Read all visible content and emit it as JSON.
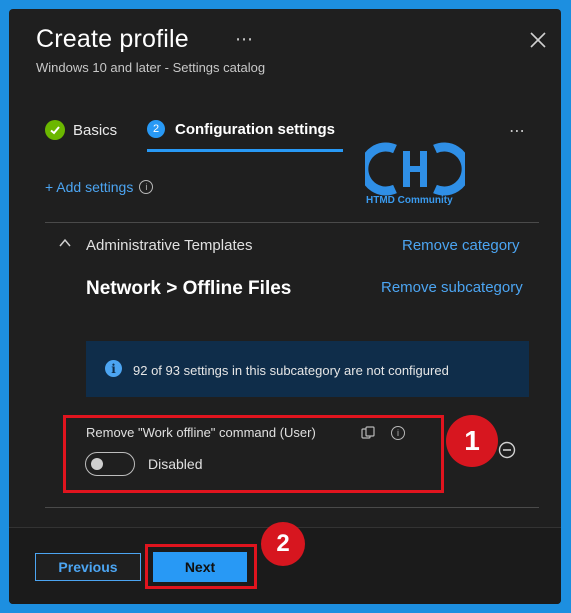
{
  "header": {
    "title": "Create profile",
    "more": "⋯",
    "subtitle": "Windows 10 and later - Settings catalog"
  },
  "tabs": [
    {
      "label": "Basics",
      "step": "✓"
    },
    {
      "label": "Configuration settings",
      "step": "2"
    }
  ],
  "tabs_more": "⋯",
  "watermark": {
    "text": "HTMD Community"
  },
  "add_settings": {
    "label": "+ Add settings",
    "info": "i"
  },
  "category": {
    "name": "Administrative Templates",
    "remove_label": "Remove category",
    "subcategory": "Network > Offline Files",
    "remove_sub_label": "Remove subcategory"
  },
  "info_banner": {
    "icon": "i",
    "text": "92 of 93 settings in this subcategory are not configured"
  },
  "setting": {
    "label": "Remove \"Work offline\" command (User)",
    "info": "i",
    "toggle_state": "Disabled"
  },
  "annotations": {
    "badge_1": "1",
    "badge_2": "2"
  },
  "footer": {
    "previous_label": "Previous",
    "next_label": "Next"
  },
  "colors": {
    "accent": "#2899f5",
    "link": "#4ca5f2",
    "highlight": "#e0141e",
    "success": "#6bb700",
    "page_bg": "#1f1f1f",
    "outer_bg": "#1d8fe0"
  }
}
